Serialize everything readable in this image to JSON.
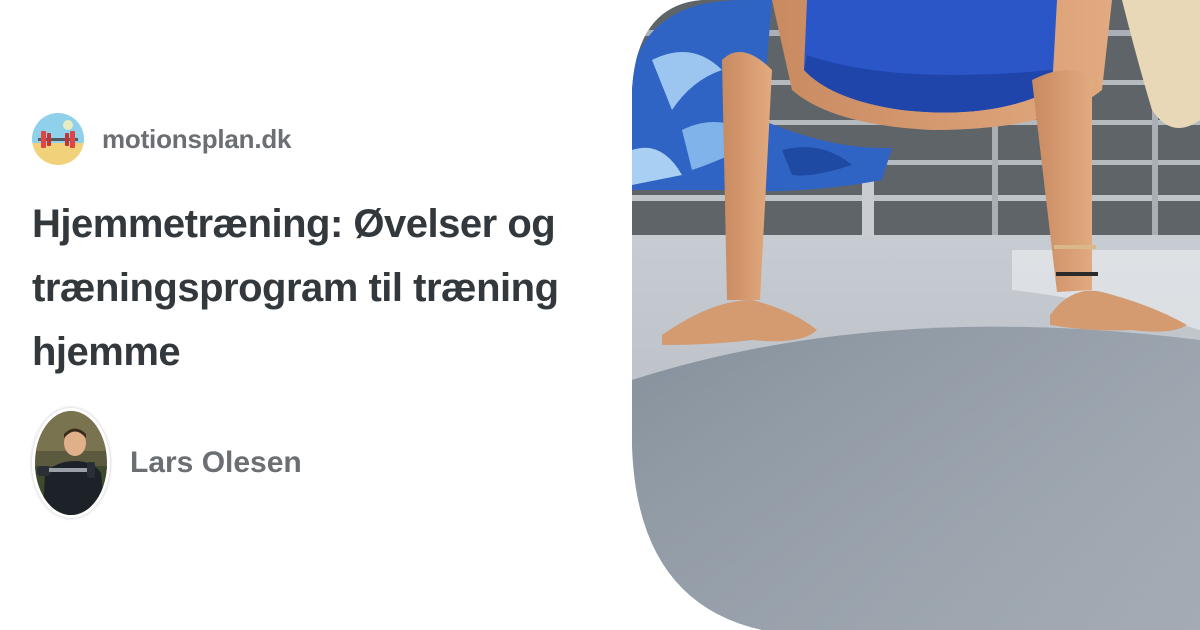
{
  "site": {
    "name": "motionsplan.dk",
    "logo_icon": "barbell-beach-logo-icon"
  },
  "article": {
    "title": "Hjemmetræning: Øvelser og træningsprogram til træning hjemme"
  },
  "author": {
    "name": "Lars Olesen",
    "avatar_icon": "author-photo-icon"
  },
  "hero": {
    "image_icon": "push-up-photo-icon"
  },
  "colors": {
    "title": "#33383d",
    "muted": "#6b6e72",
    "background": "#ffffff"
  }
}
